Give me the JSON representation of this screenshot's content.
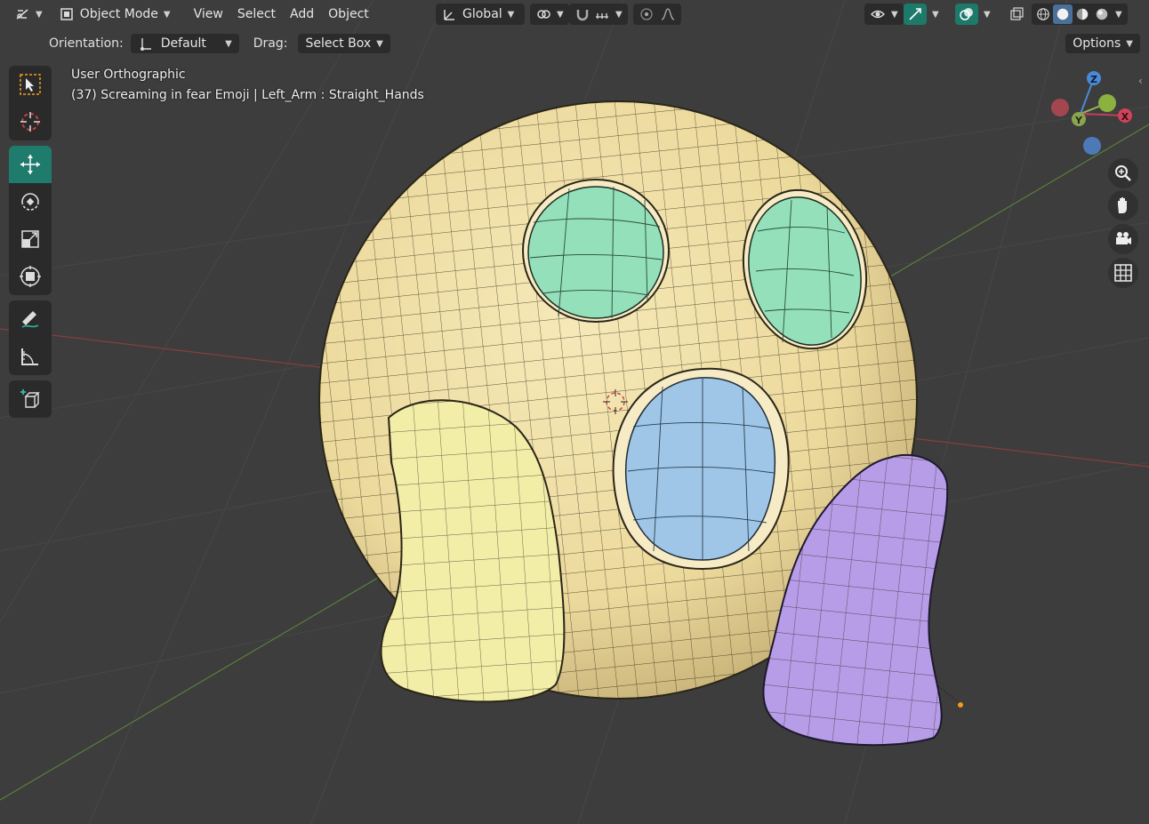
{
  "header": {
    "mode": "Object Mode",
    "menus": [
      "View",
      "Select",
      "Add",
      "Object"
    ],
    "transform_orientation": "Global",
    "options_label": "Options"
  },
  "tool_settings": {
    "orientation_label": "Orientation:",
    "orientation_value": "Default",
    "drag_label": "Drag:",
    "drag_value": "Select Box"
  },
  "viewport": {
    "view_name": "User Orthographic",
    "object_info": "(37) Screaming in fear Emoji | Left_Arm : Straight_Hands"
  },
  "gizmo": {
    "x": "X",
    "y": "Y",
    "z": "Z"
  },
  "toolbar": {
    "tools": [
      "select-box",
      "cursor",
      "move",
      "rotate",
      "scale",
      "transform",
      "annotate",
      "measure",
      "add-cube"
    ],
    "active_tool": "move"
  },
  "colors": {
    "viewport_bg": "#3d3d3d",
    "face": "#f0dfa3",
    "eyes": "#93e0ba",
    "mouth": "#9fc6e6",
    "left_hand": "#f2eda7",
    "right_hand": "#b79ce8",
    "active_tool": "#1f7c6c"
  }
}
